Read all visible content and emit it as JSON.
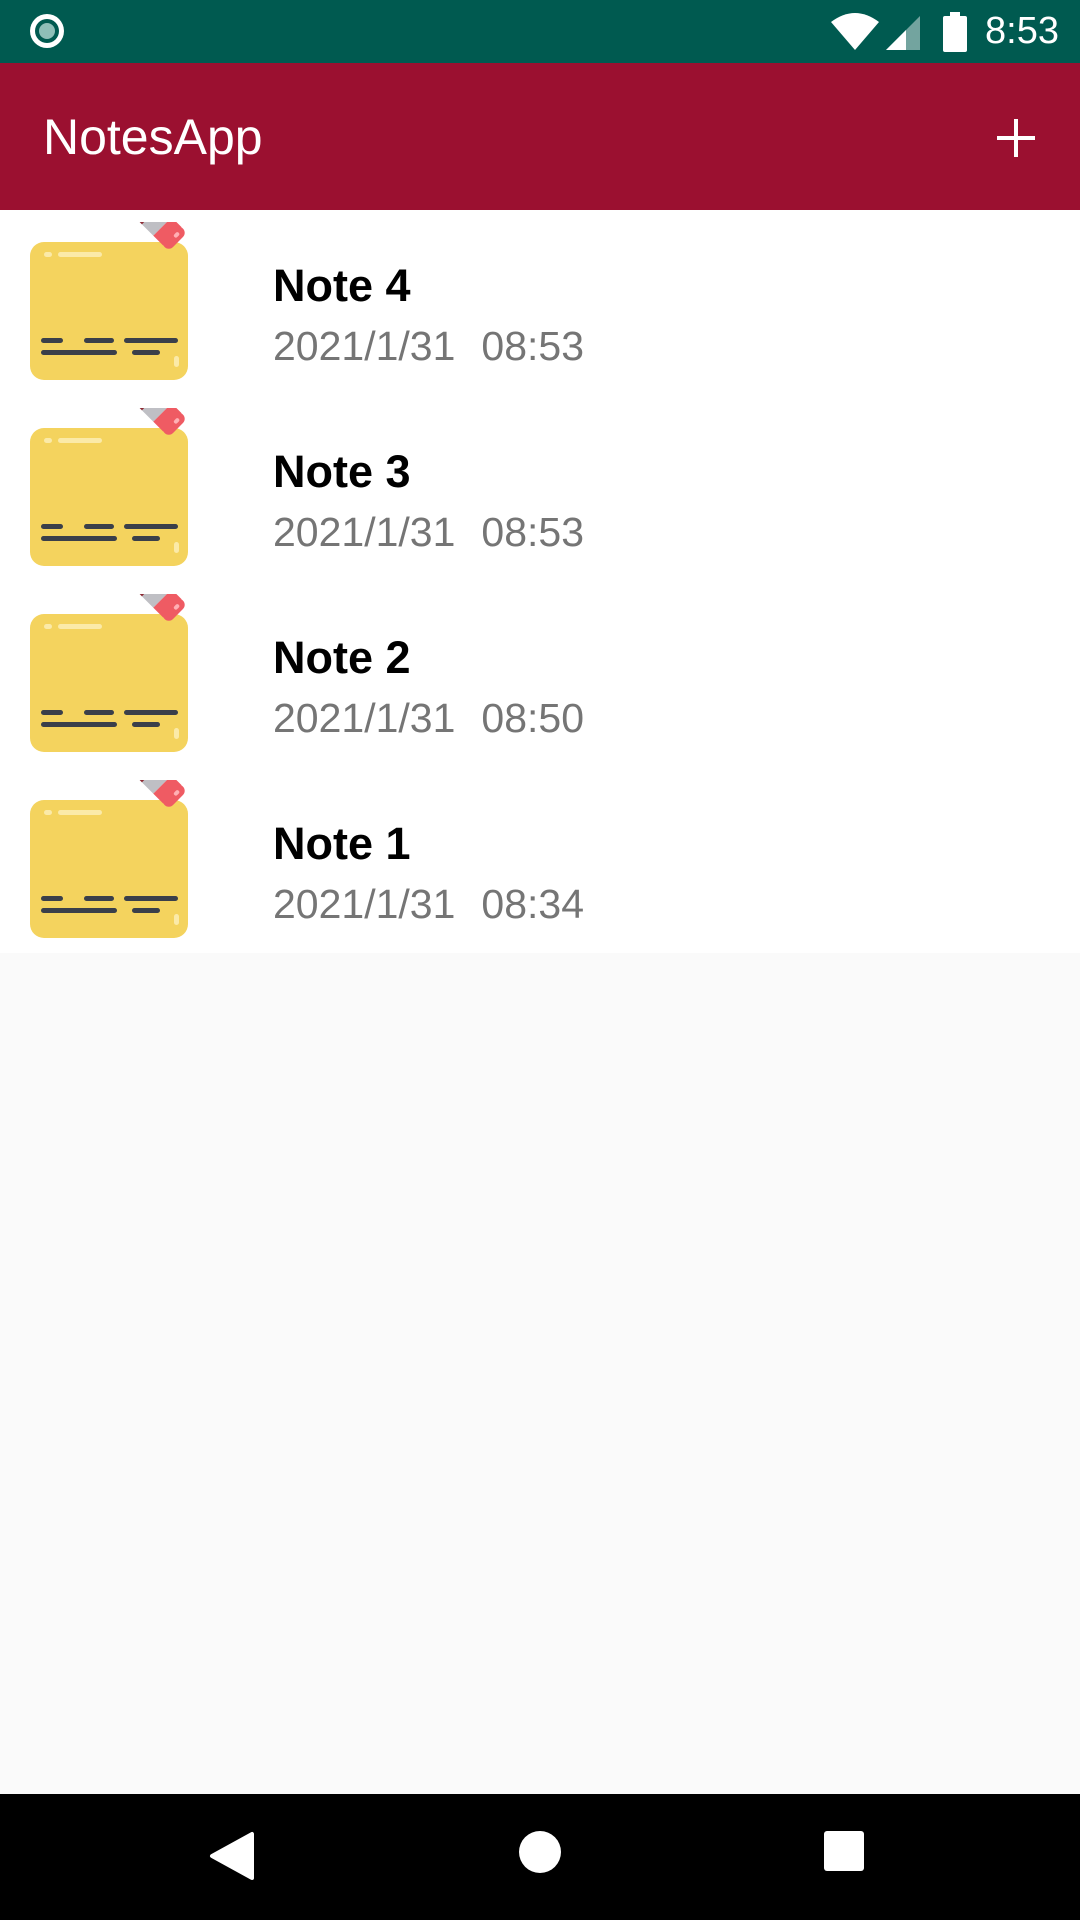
{
  "status_bar": {
    "time": "8:53",
    "icons": [
      "notification-dot-icon",
      "wifi-icon",
      "cell-signal-icon",
      "battery-icon"
    ]
  },
  "app_bar": {
    "title": "NotesApp",
    "add_icon": "plus-icon"
  },
  "notes": [
    {
      "title": "Note 4",
      "date": "2021/1/31",
      "time": "08:53"
    },
    {
      "title": "Note 3",
      "date": "2021/1/31",
      "time": "08:53"
    },
    {
      "title": "Note 2",
      "date": "2021/1/31",
      "time": "08:50"
    },
    {
      "title": "Note 1",
      "date": "2021/1/31",
      "time": "08:34"
    }
  ],
  "nav_bar": {
    "icons": [
      "back-icon",
      "home-icon",
      "recents-icon"
    ]
  },
  "colors": {
    "status_bar": "#005a50",
    "app_bar": "#9b1030",
    "note_title": "#000000",
    "note_date": "#757575",
    "background": "#fafafa"
  }
}
